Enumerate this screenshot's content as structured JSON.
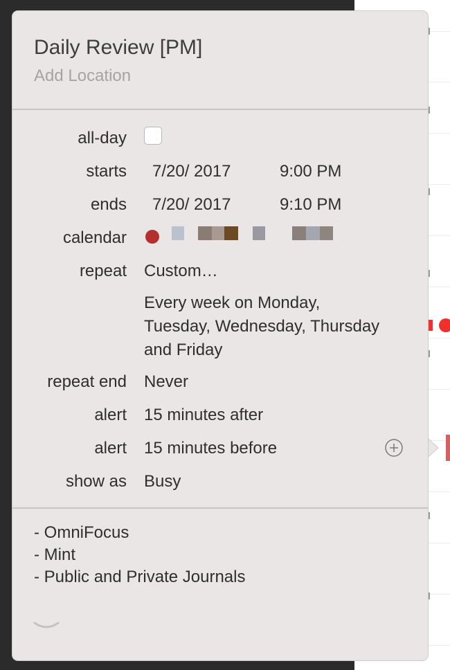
{
  "event": {
    "title": "Daily Review [PM]",
    "location_placeholder": "Add Location"
  },
  "fields": {
    "all_day_label": "all-day",
    "all_day_checked": false,
    "starts_label": "starts",
    "starts_date": "7/20/ 2017",
    "starts_time": "9:00 PM",
    "ends_label": "ends",
    "ends_date": "7/20/ 2017",
    "ends_time": "9:10 PM",
    "calendar_label": "calendar",
    "calendar_color": "#b4302c",
    "repeat_label": "repeat",
    "repeat_value": "Custom…",
    "repeat_description_lines": [
      "Every week on Monday,",
      "Tuesday, Wednesday, Thursday",
      "and Friday"
    ],
    "repeat_end_label": "repeat end",
    "repeat_end_value": "Never",
    "alert_label": "alert",
    "alert_1": "15 minutes after",
    "alert_2": "15 minutes before",
    "show_as_label": "show as",
    "show_as_value": "Busy"
  },
  "notes": [
    "- OmniFocus",
    "- Mint",
    "- Public and Private Journals"
  ],
  "icons": {
    "add_alert": "plus-circle-icon",
    "expand": "chevron-down-icon"
  },
  "colors": {
    "popover_bg": "#ebe6e6",
    "accent_event": "#f0302a"
  }
}
